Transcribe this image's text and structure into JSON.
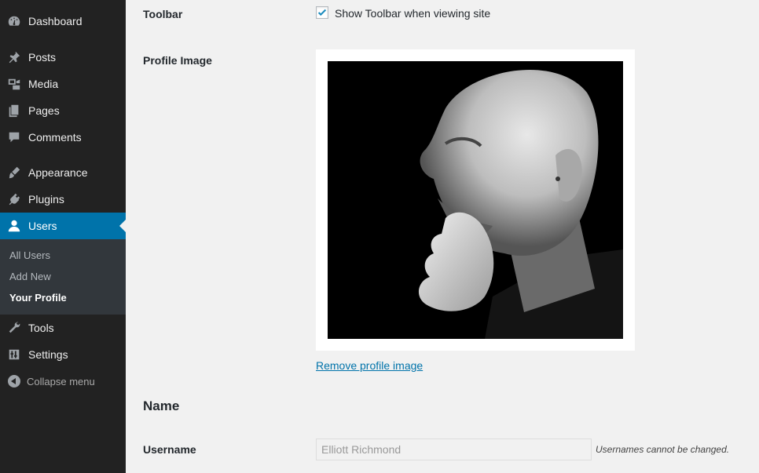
{
  "sidebar": {
    "items": [
      {
        "label": "Dashboard",
        "icon": "dashboard-icon"
      },
      {
        "label": "Posts",
        "icon": "pin-icon"
      },
      {
        "label": "Media",
        "icon": "media-icon"
      },
      {
        "label": "Pages",
        "icon": "pages-icon"
      },
      {
        "label": "Comments",
        "icon": "comment-icon"
      },
      {
        "label": "Appearance",
        "icon": "brush-icon"
      },
      {
        "label": "Plugins",
        "icon": "plug-icon"
      },
      {
        "label": "Users",
        "icon": "user-icon",
        "active": true
      },
      {
        "label": "Tools",
        "icon": "wrench-icon"
      },
      {
        "label": "Settings",
        "icon": "sliders-icon"
      }
    ],
    "submenu": [
      {
        "label": "All Users"
      },
      {
        "label": "Add New"
      },
      {
        "label": "Your Profile",
        "current": true
      }
    ],
    "collapse_label": "Collapse menu",
    "colors": {
      "background": "#222222",
      "active": "#0073aa",
      "submenu": "#32373c"
    }
  },
  "profile": {
    "toolbar": {
      "label": "Toolbar",
      "checkbox_label": "Show Toolbar when viewing site",
      "checked": true
    },
    "profile_image": {
      "label": "Profile Image",
      "remove_link": "Remove profile image"
    },
    "name_section": {
      "heading": "Name",
      "username_label": "Username",
      "username_value": "Elliott Richmond",
      "username_note": "Usernames cannot be changed."
    }
  }
}
